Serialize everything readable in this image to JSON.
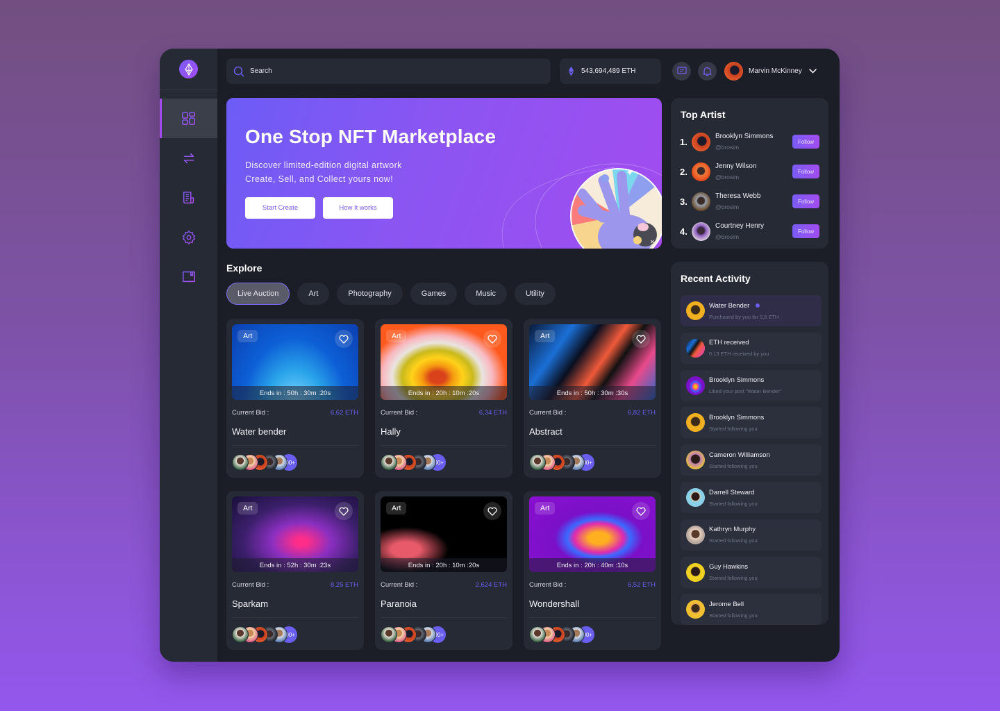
{
  "header": {
    "search_placeholder": "Search",
    "balance": "543,694,489 ETH",
    "user_name": "Marvin McKinney"
  },
  "sidebar": {
    "items": [
      {
        "name": "dashboard",
        "icon": "grid-icon",
        "active": true
      },
      {
        "name": "transfer",
        "icon": "swap-arrows-icon",
        "active": false
      },
      {
        "name": "documents",
        "icon": "receipt-icon",
        "active": false
      },
      {
        "name": "settings",
        "icon": "gear-icon",
        "active": false
      },
      {
        "name": "wallet",
        "icon": "wallet-icon",
        "active": false
      }
    ]
  },
  "hero": {
    "title": "One Stop NFT Marketplace",
    "line1": "Discover limited-edition digital artwork",
    "line2": "Create, Sell, and Collect yours now!",
    "primary_button": "Start Create",
    "secondary_button": "How It works"
  },
  "explore": {
    "title": "Explore",
    "categories": [
      "Live Auction",
      "Art",
      "Photography",
      "Games",
      "Music",
      "Utility"
    ],
    "active_category": "Live Auction"
  },
  "cards": [
    {
      "tag": "Art",
      "ends": "Ends in : 50h : 30m :20s",
      "bid_label": "Current Bid :",
      "bid": "6,62 ETH",
      "name": "Water bender",
      "more": "100+"
    },
    {
      "tag": "Art",
      "ends": "Ends in : 20h : 10m :20s",
      "bid_label": "Current Bid :",
      "bid": "6,34 ETH",
      "name": "Hally",
      "more": "100+"
    },
    {
      "tag": "Art",
      "ends": "Ends in : 50h : 30m :30s",
      "bid_label": "Current Bid :",
      "bid": "6,82 ETH",
      "name": "Abstract",
      "more": "100+"
    },
    {
      "tag": "Art",
      "ends": "Ends in : 52h : 30m :23s",
      "bid_label": "Current Bid :",
      "bid": "8,25 ETH",
      "name": "Sparkam",
      "more": "100+"
    },
    {
      "tag": "Art",
      "ends": "Ends in : 20h : 10m :20s",
      "bid_label": "Current Bid :",
      "bid": "2,624 ETH",
      "name": "Paranoia",
      "more": "100+"
    },
    {
      "tag": "Art",
      "ends": "Ends in : 20h : 40m :10s",
      "bid_label": "Current Bid :",
      "bid": "6,52 ETH",
      "name": "Wondershall",
      "more": "100+"
    }
  ],
  "top_artist": {
    "title": "Top Artist",
    "follow_label": "Follow",
    "artists": [
      {
        "rank": "1.",
        "name": "Brooklyn Simmons",
        "handle": "@brosim"
      },
      {
        "rank": "2.",
        "name": "Jenny Wilson",
        "handle": "@brosim"
      },
      {
        "rank": "3.",
        "name": "Theresa Webb",
        "handle": "@brosim"
      },
      {
        "rank": "4.",
        "name": "Courtney Henry",
        "handle": "@brosim"
      }
    ]
  },
  "recent_activity": {
    "title": "Recent Activity",
    "items": [
      {
        "title": "Water Bender",
        "subtitle": "Purchased by you for 0,5 ETH",
        "unread": true
      },
      {
        "title": "ETH received",
        "subtitle": "0.13 ETH received by you",
        "unread": false
      },
      {
        "title": "Brooklyn Simmons",
        "subtitle": "Liked your post \"Water Bender\"",
        "unread": false
      },
      {
        "title": "Brooklyn Simmons",
        "subtitle": "Started following you",
        "unread": false
      },
      {
        "title": "Cameron Williamson",
        "subtitle": "Started following you",
        "unread": false
      },
      {
        "title": "Darrell Steward",
        "subtitle": "Started following you",
        "unread": false
      },
      {
        "title": "Kathryn Murphy",
        "subtitle": "Started following you",
        "unread": false
      },
      {
        "title": "Guy Hawkins",
        "subtitle": "Started following you",
        "unread": false
      },
      {
        "title": "Jerome Bell",
        "subtitle": "Started following you",
        "unread": false
      }
    ]
  },
  "colors": {
    "accent": "#6a5ef0",
    "accent_purple": "#a24cf0",
    "panel": "#252a35",
    "app_bg": "#1b1d27"
  }
}
